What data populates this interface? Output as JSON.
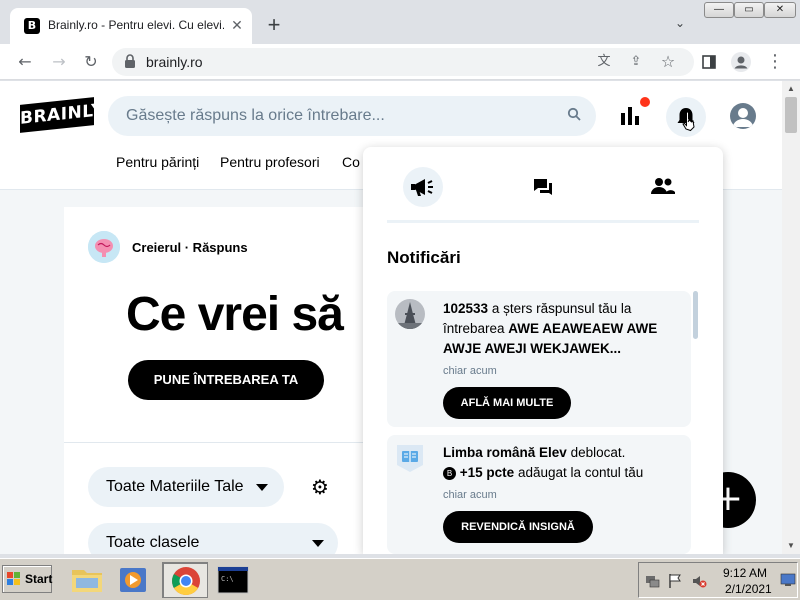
{
  "browser": {
    "tab_title": "Brainly.ro - Pentru elevi. Cu elevi.",
    "tab_favicon_letter": "B",
    "tab_close_icon": "✕",
    "new_tab_icon": "+",
    "tab_search_icon": "⌄",
    "window_controls": {
      "minimize": "—",
      "maximize": "▭",
      "close": "✕"
    },
    "url": "brainly.ro",
    "toolbar_icons": {
      "back": "←",
      "forward": "→",
      "reload": "↻",
      "lock": "🔒",
      "translate": "文",
      "share": "⇪",
      "bookmark": "☆",
      "sidebar": "▮",
      "profile": "●",
      "menu": "⋮"
    }
  },
  "site": {
    "logo_text": "BRAINLY",
    "search_placeholder": "Găsește răspuns la orice întrebare...",
    "search_icon": "⌕",
    "nav_links": [
      "Pentru părinți",
      "Pentru profesori",
      "Co"
    ],
    "brand_line": "Creierul · Răspuns",
    "hero_title": "Ce vrei să",
    "ask_button": "PUNE ÎNTREBAREA TA",
    "subject_filter": "Toate Materiile Tale",
    "grade_filter": "Toate clasele",
    "settings_icon": "⚙",
    "fab_icon": "+"
  },
  "notifications": {
    "title": "Notificări",
    "items": [
      {
        "user": "102533",
        "text_a": " a șters răspunsul tău la întrebarea ",
        "question": "AWE AEAWEAEW AWE AWJE AWEJI WEKJAWEK...",
        "time": "chiar acum",
        "button": "AFLĂ MAI MULTE"
      },
      {
        "subject": "Limba română",
        "rank": "Elev",
        "text_a": " deblocat.",
        "points": "+15 pcte",
        "points_badge": "B",
        "text_b": " adăugat la contul tău",
        "time": "chiar acum",
        "button": "REVENDICĂ INSIGNĂ"
      }
    ]
  },
  "taskbar": {
    "start_label": "Start",
    "time": "9:12 AM",
    "date": "2/1/2021"
  },
  "colors": {
    "accent_black": "#000000",
    "search_bg": "#ebf2f7",
    "badge_red": "#ff341a",
    "chrome_frame": "#dee1e6"
  }
}
